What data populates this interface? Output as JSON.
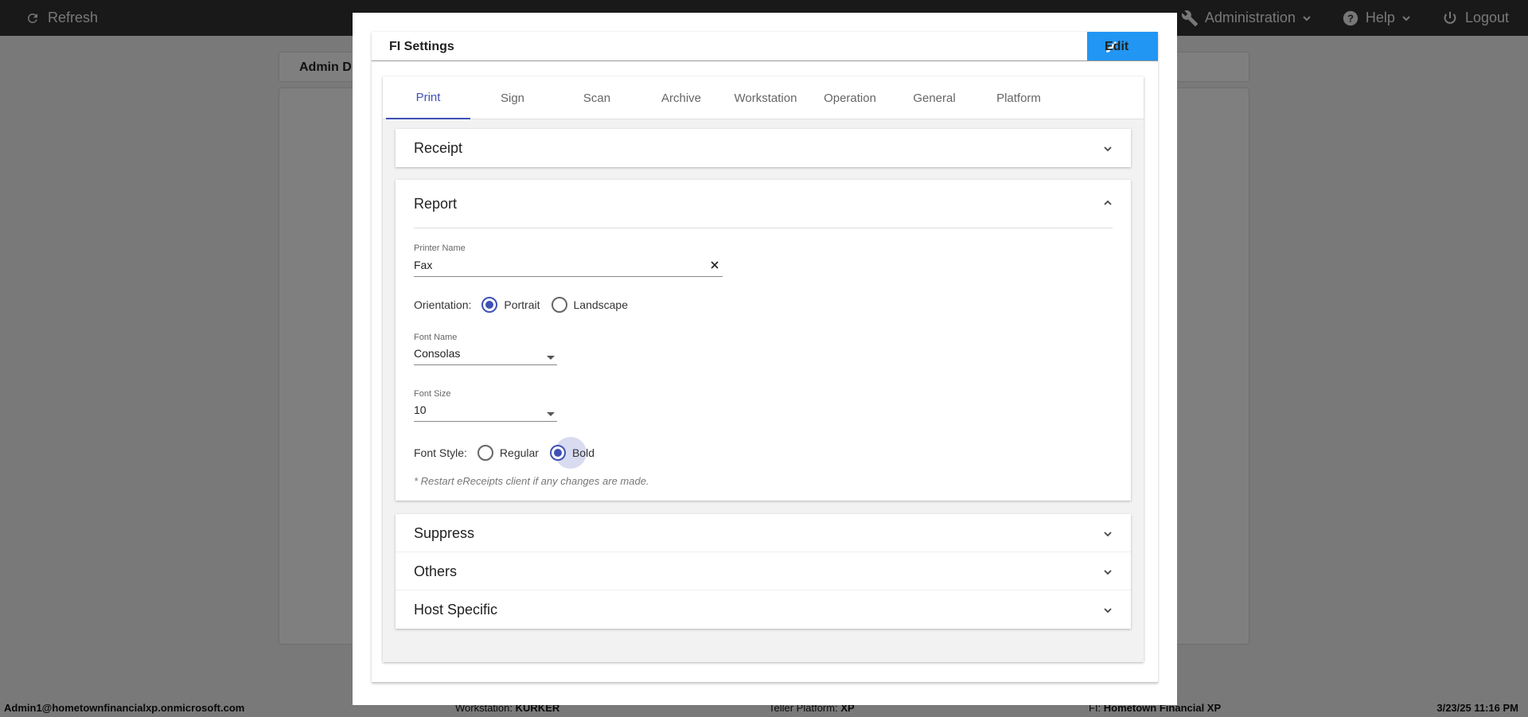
{
  "topbar": {
    "refresh_label": "Refresh",
    "administration_label": "Administration",
    "help_label": "Help",
    "logout_label": "Logout"
  },
  "background": {
    "header_title": "Admin D"
  },
  "statusbar": {
    "user": "Admin1@hometownfinancialxp.onmicrosoft.com",
    "workstation_label": "Workstation:",
    "workstation_value": "KURKER",
    "teller_platform_label": "Teller Platform:",
    "teller_platform_value": "XP",
    "fi_label": "FI:",
    "fi_value": "Hometown Financial XP",
    "datetime": "3/23/25 11:16 PM"
  },
  "modal": {
    "title": "FI Settings",
    "edit_label": "Edit",
    "tabs": [
      {
        "label": "Print",
        "active": true
      },
      {
        "label": "Sign",
        "active": false
      },
      {
        "label": "Scan",
        "active": false
      },
      {
        "label": "Archive",
        "active": false
      },
      {
        "label": "Workstation",
        "active": false
      },
      {
        "label": "Operation",
        "active": false
      },
      {
        "label": "General",
        "active": false
      },
      {
        "label": "Platform",
        "active": false
      }
    ],
    "receipt_title": "Receipt",
    "report": {
      "title": "Report",
      "printer_name_label": "Printer Name",
      "printer_name_value": "Fax",
      "orientation_label": "Orientation:",
      "orientation_options": [
        "Portrait",
        "Landscape"
      ],
      "orientation_selected": "Portrait",
      "font_name_label": "Font Name",
      "font_name_value": "Consolas",
      "font_size_label": "Font Size",
      "font_size_value": "10",
      "font_style_label": "Font Style:",
      "font_style_options": [
        "Regular",
        "Bold"
      ],
      "font_style_selected": "Bold",
      "note": "* Restart eReceipts client if any changes are made."
    },
    "collapsed_sections": [
      "Suppress",
      "Others",
      "Host Specific"
    ]
  },
  "colors": {
    "accent": "#3f51b5",
    "edit_button": "#2196f3",
    "topbar": "#333333"
  }
}
